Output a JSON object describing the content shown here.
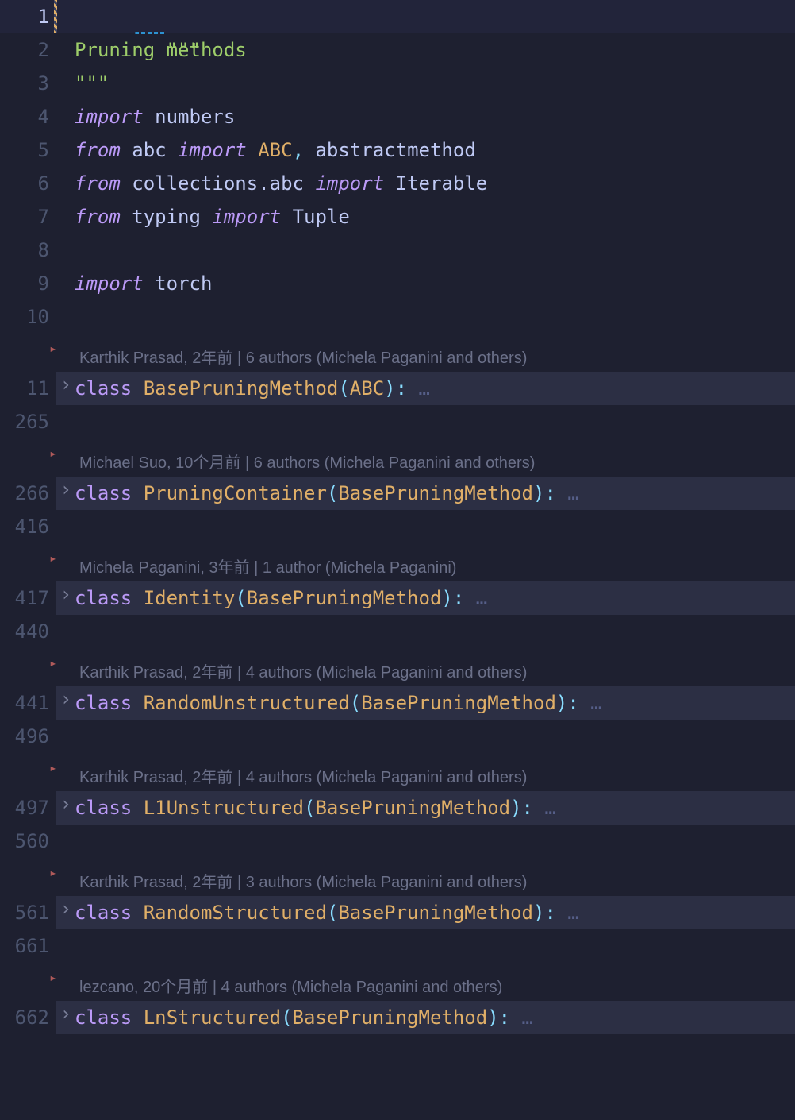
{
  "lines": {
    "l1_num": "1",
    "l1_code": "\"\"\"",
    "l2_num": "2",
    "l2_code": "Pruning methods",
    "l3_num": "3",
    "l3_code": "\"\"\"",
    "l4_num": "4",
    "l4_kw": "import",
    "l4_name": "numbers",
    "l5_num": "5",
    "l5_kw1": "from",
    "l5_mod": "abc",
    "l5_kw2": "import",
    "l5_n1": "ABC",
    "l5_comma": ",",
    "l5_n2": "abstractmethod",
    "l6_num": "6",
    "l6_kw1": "from",
    "l6_mod": "collections.abc",
    "l6_kw2": "import",
    "l6_name": "Iterable",
    "l7_num": "7",
    "l7_kw1": "from",
    "l7_mod": "typing",
    "l7_kw2": "import",
    "l7_name": "Tuple",
    "l8_num": "8",
    "l9_num": "9",
    "l9_kw": "import",
    "l9_name": "torch",
    "l10_num": "10"
  },
  "blocks": [
    {
      "lens": "Karthik Prasad, 2年前 | 6 authors (Michela Paganini and others)",
      "line_start": "11",
      "class_name": "BasePruningMethod",
      "base": "ABC",
      "line_end": "265"
    },
    {
      "lens": "Michael Suo, 10个月前 | 6 authors (Michela Paganini and others)",
      "line_start": "266",
      "class_name": "PruningContainer",
      "base": "BasePruningMethod",
      "line_end": "416"
    },
    {
      "lens": "Michela Paganini, 3年前 | 1 author (Michela Paganini)",
      "line_start": "417",
      "class_name": "Identity",
      "base": "BasePruningMethod",
      "line_end": "440"
    },
    {
      "lens": "Karthik Prasad, 2年前 | 4 authors (Michela Paganini and others)",
      "line_start": "441",
      "class_name": "RandomUnstructured",
      "base": "BasePruningMethod",
      "line_end": "496"
    },
    {
      "lens": "Karthik Prasad, 2年前 | 4 authors (Michela Paganini and others)",
      "line_start": "497",
      "class_name": "L1Unstructured",
      "base": "BasePruningMethod",
      "line_end": "560"
    },
    {
      "lens": "Karthik Prasad, 2年前 | 3 authors (Michela Paganini and others)",
      "line_start": "561",
      "class_name": "RandomStructured",
      "base": "BasePruningMethod",
      "line_end": "661"
    },
    {
      "lens": "lezcano, 20个月前 | 4 authors (Michela Paganini and others)",
      "line_start": "662",
      "class_name": "LnStructured",
      "base": "BasePruningMethod",
      "line_end": ""
    }
  ],
  "kw_class": "class",
  "fold_arrow": "›",
  "fold_indicator": "▸",
  "ellipsis": "…"
}
